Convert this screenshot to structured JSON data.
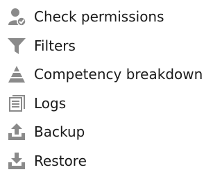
{
  "menu": {
    "items": [
      {
        "label": "Check permissions",
        "icon": "user-check-icon"
      },
      {
        "label": "Filters",
        "icon": "filter-icon"
      },
      {
        "label": "Competency breakdown",
        "icon": "stacked-triangle-icon"
      },
      {
        "label": "Logs",
        "icon": "log-sheet-icon"
      },
      {
        "label": "Backup",
        "icon": "upload-tray-icon"
      },
      {
        "label": "Restore",
        "icon": "download-tray-icon"
      }
    ]
  },
  "colors": {
    "icon": "#8a8a8a",
    "text": "#1a1a1a",
    "background": "#ffffff"
  }
}
